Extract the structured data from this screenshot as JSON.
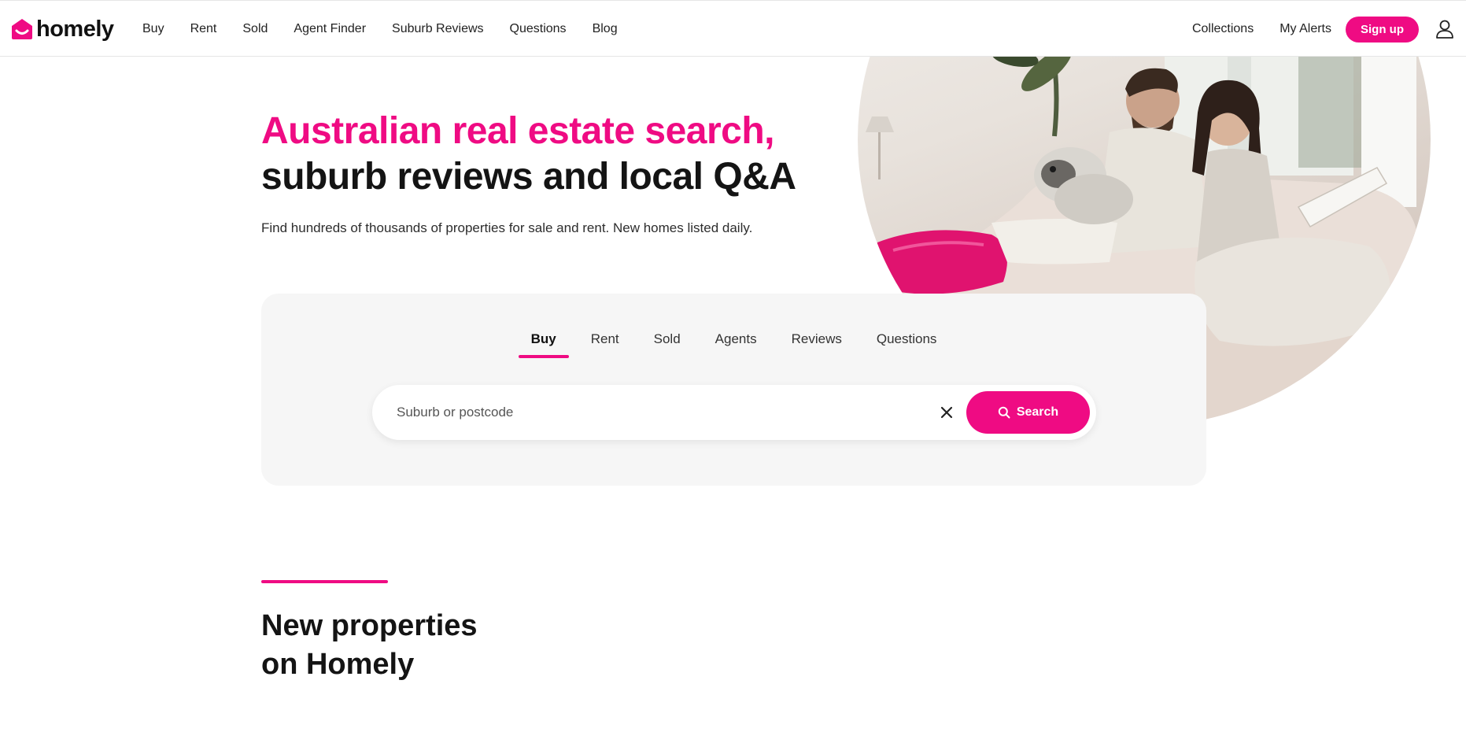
{
  "brand": {
    "name": "homely",
    "accent_color": "#ef0b83"
  },
  "nav": {
    "left_links": [
      "Buy",
      "Rent",
      "Sold",
      "Agent Finder",
      "Suburb Reviews",
      "Questions",
      "Blog"
    ],
    "right_links": [
      "Collections",
      "My Alerts"
    ],
    "signup_label": "Sign up",
    "account_icon": "user-icon"
  },
  "hero": {
    "title_line1": "Australian real estate search,",
    "title_line2": "suburb reviews and local Q&A",
    "subtitle": "Find hundreds of thousands of properties for sale and rent. New homes listed daily.",
    "image": "couple-on-sofa-with-dog-photo"
  },
  "search": {
    "tabs": [
      "Buy",
      "Rent",
      "Sold",
      "Agents",
      "Reviews",
      "Questions"
    ],
    "active_tab": "Buy",
    "placeholder": "Suburb or postcode",
    "value": "",
    "clear_icon": "close-icon",
    "button_label": "Search",
    "button_icon": "search-icon"
  },
  "new_properties": {
    "title_line1": "New properties",
    "title_line2": "on Homely"
  }
}
